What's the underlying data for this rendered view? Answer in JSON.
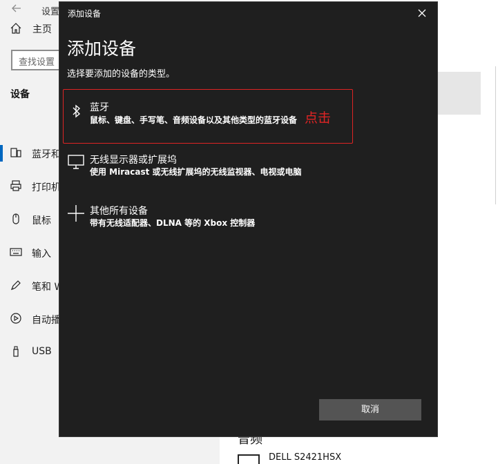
{
  "settings": {
    "window_title": "设置",
    "home_label": "主页",
    "search_placeholder": "查找设置",
    "section_title": "设备",
    "nav": [
      {
        "label": "蓝牙和"
      },
      {
        "label": "打印机"
      },
      {
        "label": "鼠标"
      },
      {
        "label": "输入"
      },
      {
        "label": "笔和 W"
      },
      {
        "label": "自动播"
      },
      {
        "label": "USB"
      }
    ],
    "audio_heading": "音频",
    "monitor_name": "DELL S2421HSX"
  },
  "dialog": {
    "title": "添加设备",
    "heading": "添加设备",
    "subtitle": "选择要添加的设备的类型。",
    "options": [
      {
        "name": "蓝牙",
        "desc": "鼠标、键盘、手写笔、音频设备以及其他类型的蓝牙设备",
        "icon": "bluetooth-icon"
      },
      {
        "name": "无线显示器或扩展坞",
        "desc": "使用 Miracast 或无线扩展坞的无线监视器、电视或电脑",
        "icon": "monitor-icon"
      },
      {
        "name": "其他所有设备",
        "desc": "带有无线适配器、DLNA 等的 Xbox 控制器",
        "icon": "plus-icon"
      }
    ],
    "annotation": "点击",
    "cancel_label": "取消"
  },
  "colors": {
    "dialog_bg": "#1f1f1f",
    "highlight": "#e02424",
    "accent": "#0067c0",
    "button_bg": "#545454"
  }
}
